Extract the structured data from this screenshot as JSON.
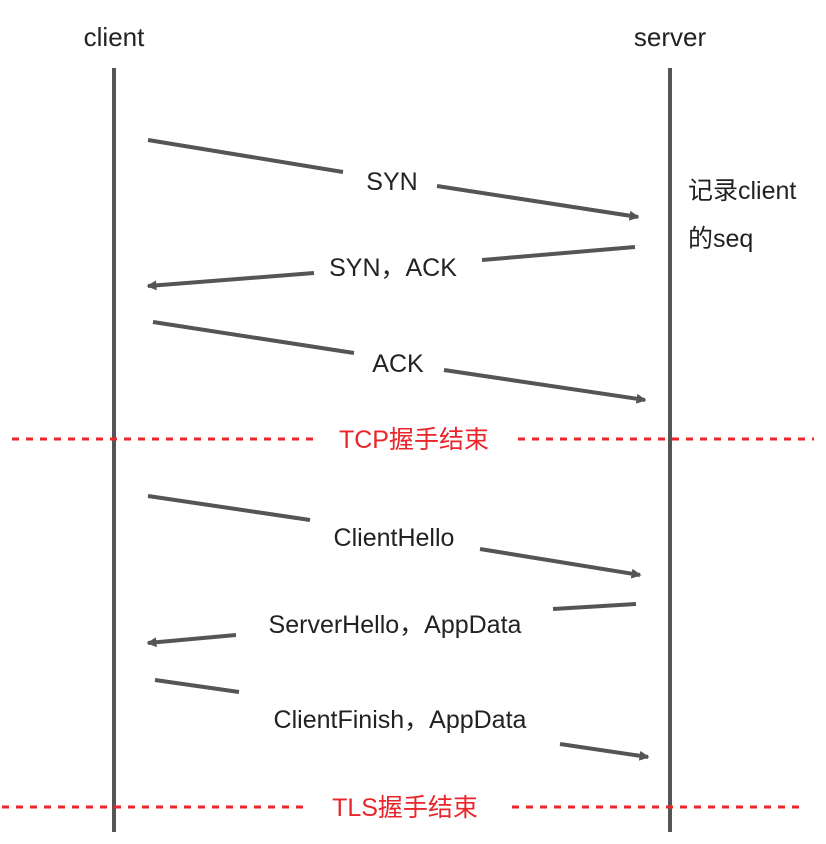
{
  "participants": {
    "client": "client",
    "server": "server"
  },
  "messages": [
    {
      "label": "SYN",
      "direction": "client-to-server"
    },
    {
      "label": "SYN，ACK",
      "direction": "server-to-client"
    },
    {
      "label": "ACK",
      "direction": "client-to-server"
    },
    {
      "label": "ClientHello",
      "direction": "client-to-server"
    },
    {
      "label": "ServerHello，AppData",
      "direction": "server-to-client"
    },
    {
      "label": "ClientFinish，AppData",
      "direction": "client-to-server"
    }
  ],
  "server_note": {
    "line1": "记录client",
    "line2": "的seq"
  },
  "dividers": [
    {
      "label": "TCP握手结束"
    },
    {
      "label": "TLS握手结束"
    }
  ],
  "colors": {
    "lifeline": "#555555",
    "arrow": "#555555",
    "divider": "#e8262b",
    "text": "#222222"
  }
}
